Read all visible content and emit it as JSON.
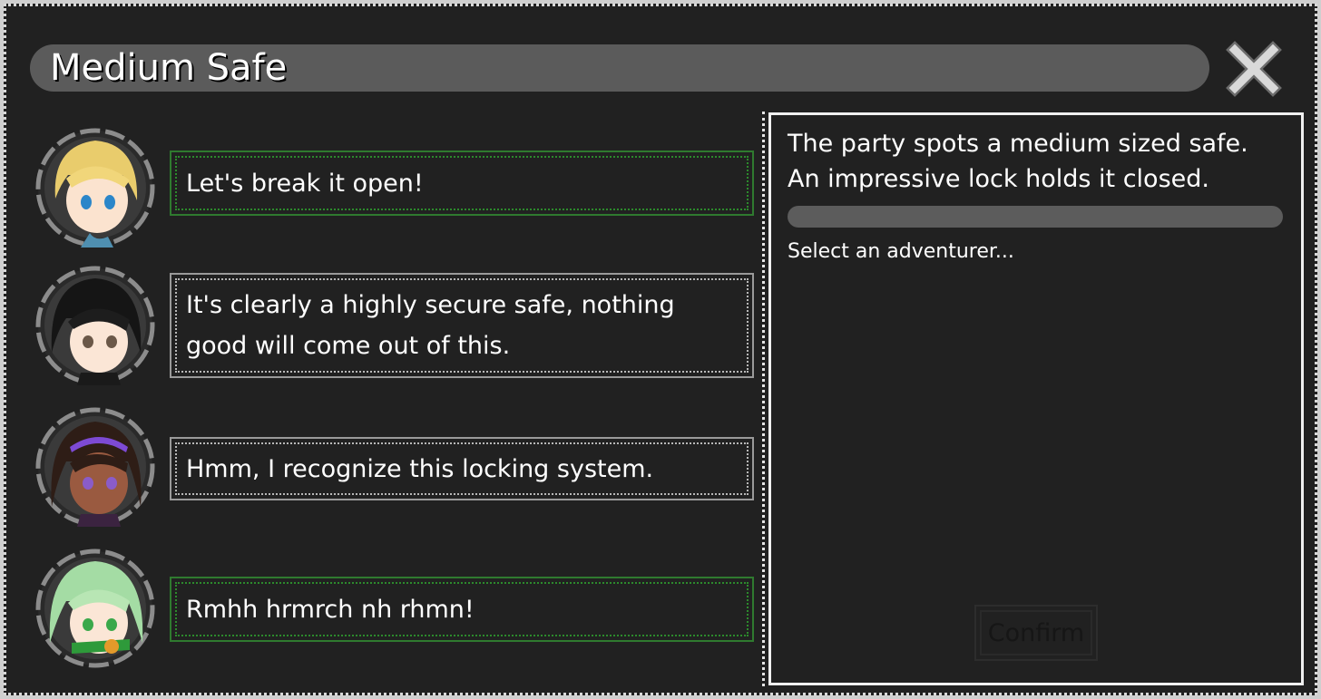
{
  "dialog": {
    "title": "Medium Safe",
    "close_icon": "close-x-icon"
  },
  "party": [
    {
      "portrait": "blonde-adventurer-portrait",
      "line": "Let's break it open!",
      "border": "green"
    },
    {
      "portrait": "black-haired-adventurer-portrait",
      "line": "It's clearly a highly secure safe, nothing good will come out of this.",
      "border": "gray"
    },
    {
      "portrait": "headband-adventurer-portrait",
      "line": "Hmm, I recognize this locking system.",
      "border": "gray"
    },
    {
      "portrait": "green-haired-adventurer-portrait",
      "line": "Rmhh hrmrch nh rhmn!",
      "border": "green"
    }
  ],
  "event": {
    "description_line1": "The party spots a medium sized safe.",
    "description_line2": "An impressive lock holds it closed.",
    "progress": 0,
    "prompt": "Select an adventurer...",
    "confirm_label": "Confirm"
  },
  "colors": {
    "background": "#212121",
    "title_bar": "#5b5b5b",
    "approve_border": "#2c8a2c",
    "neutral_border": "#b8b8b8",
    "confirm_disabled_text": "#161616"
  }
}
